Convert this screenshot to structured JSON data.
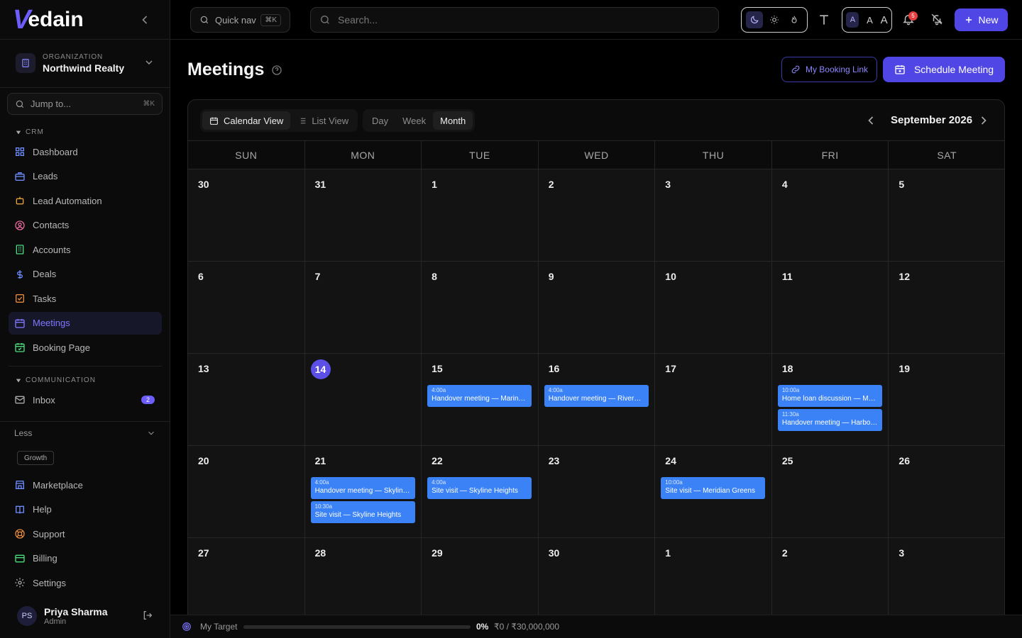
{
  "brand": {
    "logo_v": "V",
    "logo_text": "edain"
  },
  "org": {
    "label": "ORGANIZATION",
    "name": "Northwind Realty"
  },
  "jump": {
    "placeholder": "Jump to...",
    "shortcut": "⌘K"
  },
  "sections": {
    "crm": "CRM",
    "communication": "COMMUNICATION"
  },
  "crm_items": [
    {
      "label": "Dashboard",
      "icon": "grid-icon"
    },
    {
      "label": "Leads",
      "icon": "briefcase-icon"
    },
    {
      "label": "Lead Automation",
      "icon": "robot-icon"
    },
    {
      "label": "Contacts",
      "icon": "contact-icon"
    },
    {
      "label": "Accounts",
      "icon": "building-icon"
    },
    {
      "label": "Deals",
      "icon": "dollar-icon"
    },
    {
      "label": "Tasks",
      "icon": "checkbox-icon"
    },
    {
      "label": "Meetings",
      "icon": "calendar-icon",
      "active": true
    },
    {
      "label": "Booking Page",
      "icon": "calendar-check-icon"
    }
  ],
  "comm_items": [
    {
      "label": "Inbox",
      "icon": "mail-icon",
      "badge": "2"
    }
  ],
  "less": {
    "label": "Less"
  },
  "plan": {
    "label": "Growth"
  },
  "footer_items": [
    {
      "label": "Marketplace",
      "icon": "store-icon"
    },
    {
      "label": "Help",
      "icon": "book-icon"
    },
    {
      "label": "Support",
      "icon": "lifebuoy-icon"
    },
    {
      "label": "Billing",
      "icon": "card-icon"
    },
    {
      "label": "Settings",
      "icon": "gear-icon"
    }
  ],
  "user": {
    "initials": "PS",
    "name": "Priya Sharma",
    "role": "Admin"
  },
  "topbar": {
    "quicknav": "Quick nav",
    "quicknav_key": "⌘K",
    "search_placeholder": "Search...",
    "font_sizes": [
      "A",
      "A",
      "A"
    ],
    "notif_count": "5",
    "new_label": "New"
  },
  "page": {
    "title": "Meetings",
    "booking_link": "My Booking Link",
    "schedule": "Schedule Meeting"
  },
  "views": {
    "calendar": "Calendar View",
    "list": "List View",
    "day": "Day",
    "week": "Week",
    "month": "Month"
  },
  "calendar": {
    "month_label": "September 2026",
    "weekdays": [
      "SUN",
      "MON",
      "TUE",
      "WED",
      "THU",
      "FRI",
      "SAT"
    ],
    "weeks": [
      [
        "30",
        "31",
        "1",
        "2",
        "3",
        "4",
        "5"
      ],
      [
        "6",
        "7",
        "8",
        "9",
        "10",
        "11",
        "12"
      ],
      [
        "13",
        "14",
        "15",
        "16",
        "17",
        "18",
        "19"
      ],
      [
        "20",
        "21",
        "22",
        "23",
        "24",
        "25",
        "26"
      ],
      [
        "27",
        "28",
        "29",
        "30",
        "1",
        "2",
        "3"
      ]
    ],
    "today": "14",
    "events": [
      {
        "week": 2,
        "day": 2,
        "slot": 0,
        "time": "4:00a",
        "title": "Handover meeting — Marina ..."
      },
      {
        "week": 2,
        "day": 3,
        "slot": 0,
        "time": "4:00a",
        "title": "Handover meeting — Riversi..."
      },
      {
        "week": 2,
        "day": 5,
        "slot": 0,
        "time": "10:00a",
        "title": "Home loan discussion — Mari..."
      },
      {
        "week": 2,
        "day": 5,
        "slot": 1,
        "time": "11:30a",
        "title": "Handover meeting — Harbor ..."
      },
      {
        "week": 3,
        "day": 1,
        "slot": 0,
        "time": "4:00a",
        "title": "Handover meeting — Skyline ..."
      },
      {
        "week": 3,
        "day": 1,
        "slot": 1,
        "time": "10:30a",
        "title": "Site visit — Skyline Heights"
      },
      {
        "week": 3,
        "day": 2,
        "slot": 0,
        "time": "4:00a",
        "title": "Site visit — Skyline Heights"
      },
      {
        "week": 3,
        "day": 4,
        "slot": 0,
        "time": "10:00a",
        "title": "Site visit — Meridian Greens"
      }
    ]
  },
  "target": {
    "label": "My Target",
    "percent": "0%",
    "progress": 0,
    "amount": "₹0 / ₹30,000,000"
  },
  "colors": {
    "accent": "#4f46e5",
    "event": "#3b82f6",
    "active_nav": "#7f77ff"
  }
}
